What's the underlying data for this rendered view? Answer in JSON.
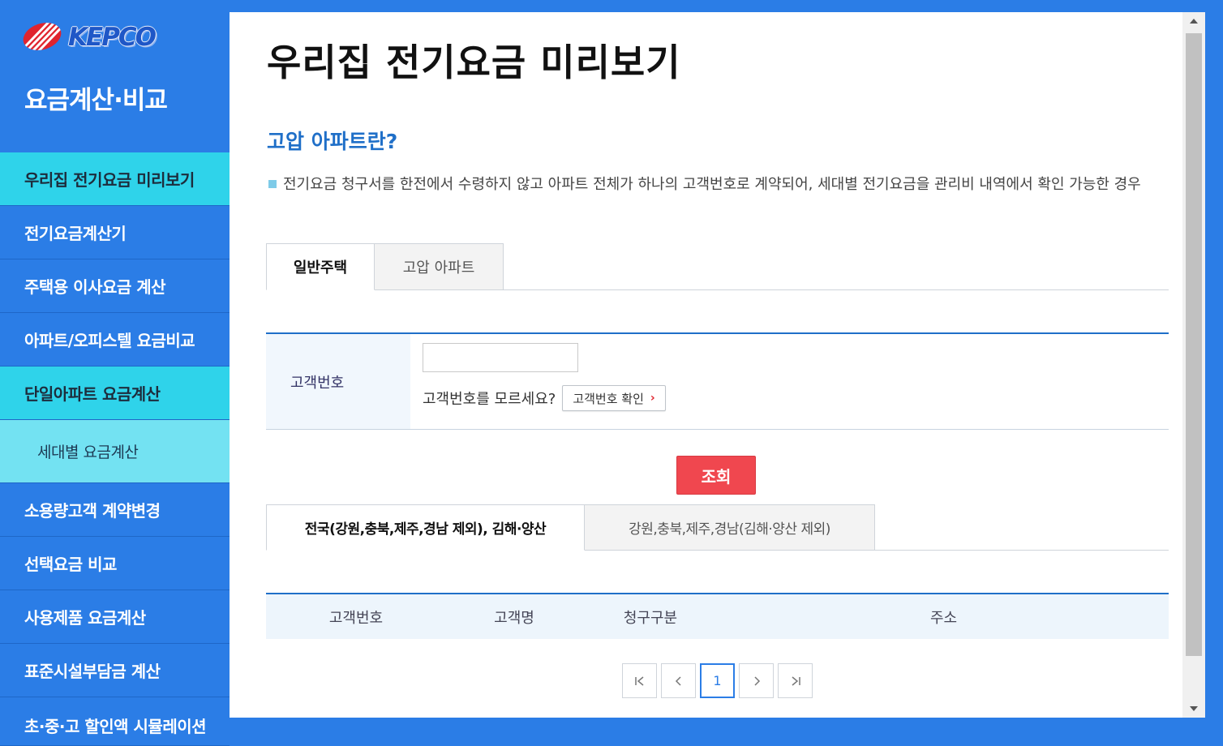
{
  "brand": {
    "logo_text": "KEPCO",
    "logo_color": "#1f57c7",
    "logo_mark_color": "#e0242e"
  },
  "sidebar": {
    "app_title": "요금계산·비교",
    "items": [
      {
        "label": "우리집 전기요금 미리보기",
        "state": "active"
      },
      {
        "label": "전기요금계산기"
      },
      {
        "label": "주택용 이사요금 계산"
      },
      {
        "label": "아파트/오피스텔 요금비교"
      },
      {
        "label": "단일아파트 요금계산",
        "state": "active"
      },
      {
        "label": "세대별 요금계산",
        "state": "sub"
      },
      {
        "label": "소용량고객 계약변경"
      },
      {
        "label": "선택요금 비교"
      },
      {
        "label": "사용제품 요금계산"
      },
      {
        "label": "표준시설부담금 계산"
      },
      {
        "label": "초·중·고 할인액 시뮬레이션"
      }
    ]
  },
  "main": {
    "page_title": "우리집 전기요금 미리보기",
    "section_heading": "고압 아파트란?",
    "description": "전기요금 청구서를 한전에서 수령하지 않고 아파트 전체가 하나의 고객번호로 계약되어, 세대별 전기요금을 관리비 내역에서 확인 가능한 경우",
    "tabs": [
      {
        "label": "일반주택",
        "selected": true
      },
      {
        "label": "고압 아파트",
        "selected": false
      }
    ],
    "form": {
      "customer_number_label": "고객번호",
      "customer_number_value": "",
      "hint_text": "고객번호를 모르세요?",
      "check_button_label": "고객번호 확인"
    },
    "search_button_label": "조회",
    "region_tabs": [
      {
        "label": "전국(강원,충북,제주,경남 제외), 김해·양산",
        "selected": true
      },
      {
        "label": "강원,충북,제주,경남(김해·양산 제외)",
        "selected": false
      }
    ],
    "table": {
      "columns": [
        "고객번호",
        "고객명",
        "청구구분",
        "주소"
      ]
    },
    "pagination": {
      "current_page": "1"
    }
  },
  "colors": {
    "background": "#2b7de6",
    "active_menu": "#2fd3ea",
    "sub_menu": "#73e2f2",
    "accent": "#1f6fc8",
    "search_button": "#f0474f"
  }
}
